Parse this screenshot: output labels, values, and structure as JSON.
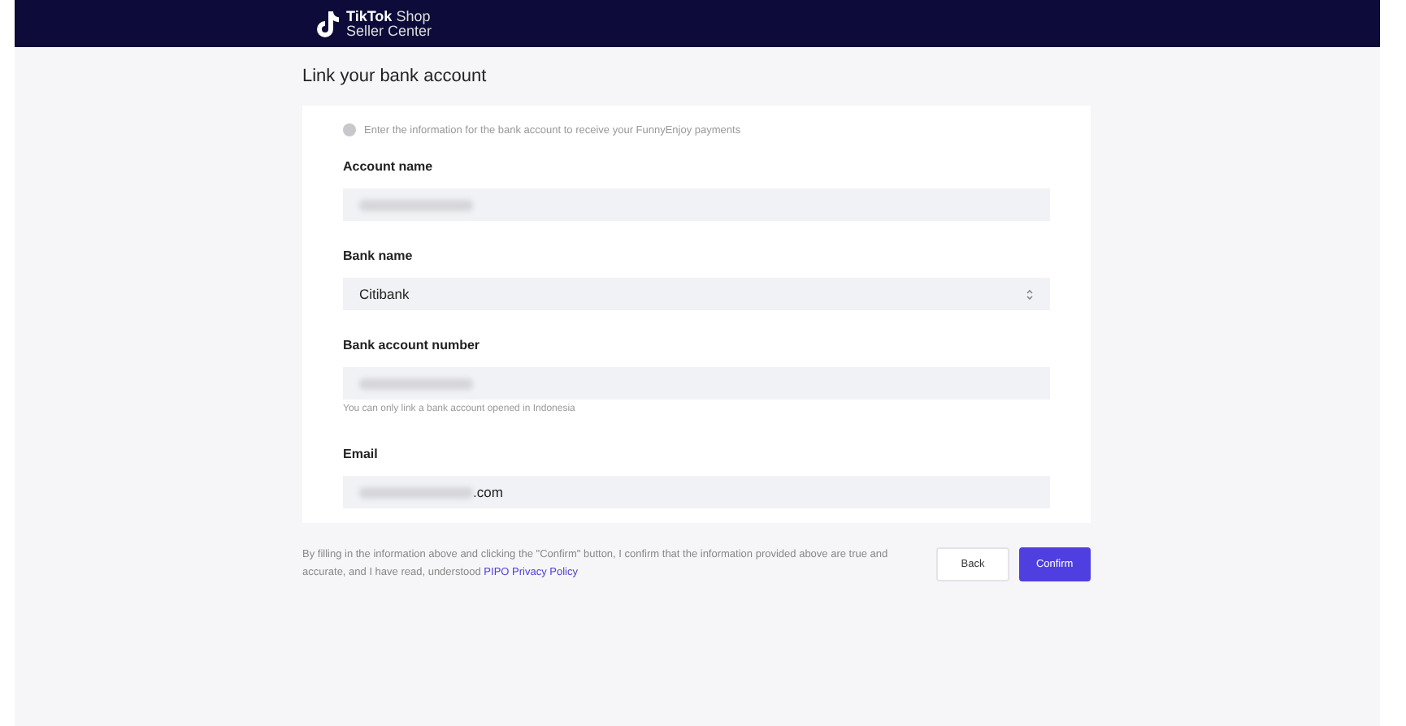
{
  "header": {
    "logo_bold": "TikTok",
    "logo_light": "Shop",
    "logo_sub": "Seller Center"
  },
  "title": "Link your bank account",
  "notice": "Enter the information for the bank account to receive your FunnyEnjoy payments",
  "fields": [
    {
      "kind": "text",
      "label": "Account name",
      "redacted": true
    },
    {
      "kind": "select",
      "label": "Bank name",
      "value": "Citibank",
      "redacted": false
    },
    {
      "kind": "text",
      "label": "Bank account number",
      "redacted": true,
      "hint": "You can only link a bank account opened in Indonesia"
    },
    {
      "kind": "text",
      "label": "Email",
      "value": ".com",
      "redacted": true
    }
  ],
  "consent": "By filling in the information above and clicking the \"Confirm\" button, I confirm that the information provided above are true and accurate, and I have read, understood ",
  "consent_link": "PIPO Privacy Policy",
  "buttons": [
    {
      "kind": "secondary",
      "label": "Back"
    },
    {
      "kind": "primary",
      "label": "Confirm"
    }
  ]
}
